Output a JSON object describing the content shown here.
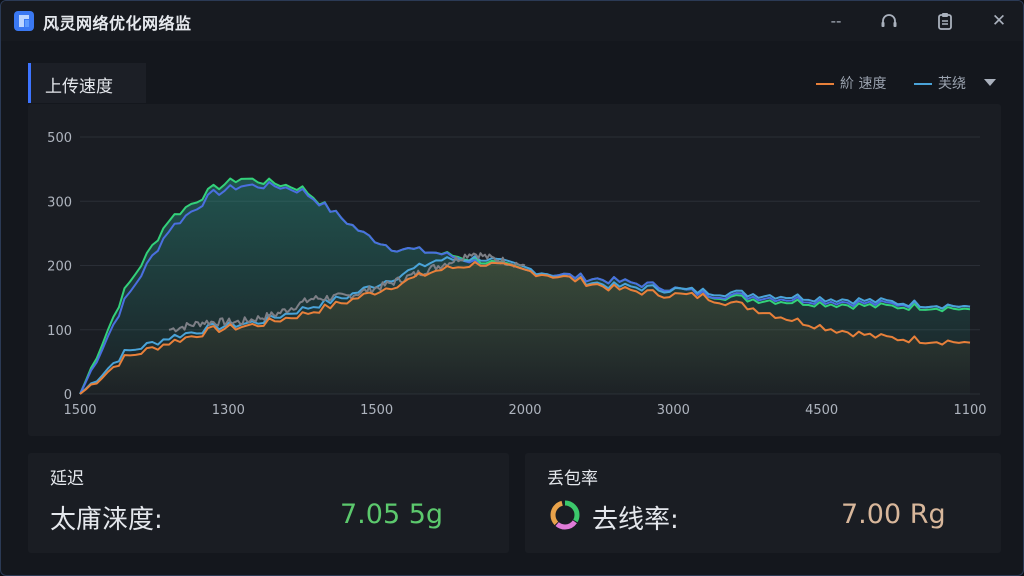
{
  "window": {
    "title": "风灵网络优化网络监",
    "controls": {
      "minimize": "--",
      "headset": "headset-icon",
      "clipboard": "clipboard-icon",
      "close": "✕"
    }
  },
  "chart_tab": {
    "label": "上传速度"
  },
  "legend": {
    "items": [
      {
        "label": "紒 速度",
        "color": "#e8803a"
      },
      {
        "label": "芙绕",
        "color": "#4aa3d8"
      }
    ]
  },
  "chart_data": {
    "type": "line",
    "y_ticks": [
      "500",
      "300",
      "200",
      "100",
      "0"
    ],
    "x_ticks": [
      "1500",
      "1300",
      "1500",
      "2000",
      "3000",
      "4500",
      "1100"
    ],
    "grid": true,
    "series": [
      {
        "color": "#33d17a",
        "x": [
          0,
          0.05,
          0.1,
          0.15,
          0.18,
          0.22,
          0.25,
          0.28,
          0.32,
          0.35,
          0.4,
          0.45,
          0.5,
          0.55,
          0.6,
          0.65,
          0.7,
          0.75,
          0.8,
          0.85,
          0.9,
          0.95,
          1.0
        ],
        "values": [
          0,
          40,
          68,
          80,
          84,
          82,
          80,
          72,
          62,
          57,
          55,
          52,
          48,
          46,
          44,
          42,
          39,
          37,
          36,
          35,
          34,
          34,
          33
        ]
      },
      {
        "color": "#4a6fe0",
        "x": [
          0,
          0.05,
          0.1,
          0.15,
          0.18,
          0.22,
          0.25,
          0.28,
          0.32,
          0.35,
          0.4,
          0.45,
          0.5,
          0.55,
          0.6,
          0.65,
          0.7,
          0.75,
          0.8,
          0.85,
          0.9,
          0.95,
          1.0
        ],
        "values": [
          0,
          36,
          64,
          78,
          81,
          81,
          79,
          72,
          62,
          57,
          55,
          51,
          48,
          46,
          44,
          42,
          39,
          38,
          37,
          36,
          35,
          35,
          34
        ]
      },
      {
        "color": "#4aa3d8",
        "x": [
          0,
          0.05,
          0.1,
          0.15,
          0.2,
          0.25,
          0.3,
          0.35,
          0.4,
          0.45,
          0.5,
          0.55,
          0.6,
          0.65,
          0.7,
          0.75,
          0.8,
          0.85,
          0.9,
          0.95,
          1.0
        ],
        "values": [
          0,
          16,
          22,
          26,
          28,
          33,
          38,
          45,
          52,
          53,
          49,
          45,
          42,
          41,
          40,
          39,
          38,
          37,
          36,
          35,
          34
        ]
      },
      {
        "color": "#7d7f86",
        "x": [
          0.1,
          0.14,
          0.18,
          0.22,
          0.26,
          0.3,
          0.34,
          0.38,
          0.42,
          0.44,
          0.46,
          0.5
        ],
        "values": [
          25,
          28,
          28,
          31,
          37,
          38,
          42,
          47,
          52,
          55,
          53,
          50
        ]
      },
      {
        "color": "#e8803a",
        "x": [
          0,
          0.05,
          0.1,
          0.15,
          0.2,
          0.25,
          0.3,
          0.35,
          0.4,
          0.45,
          0.5,
          0.55,
          0.6,
          0.65,
          0.7,
          0.75,
          0.8,
          0.85,
          0.9,
          0.95,
          1.0
        ],
        "values": [
          0,
          14,
          20,
          25,
          27,
          31,
          36,
          42,
          48,
          51,
          48,
          45,
          41,
          39,
          38,
          34,
          29,
          25,
          22,
          21,
          20
        ]
      }
    ]
  },
  "latency_card": {
    "title": "延迟",
    "label": "太庯涞度:",
    "value": "7.05 5g",
    "value_color": "#5cc96d"
  },
  "loss_card": {
    "title": "丢包率",
    "label": "去线率:",
    "value": "7.00 Rg",
    "value_color": "#d8b79b",
    "icon": "ring-icon"
  }
}
